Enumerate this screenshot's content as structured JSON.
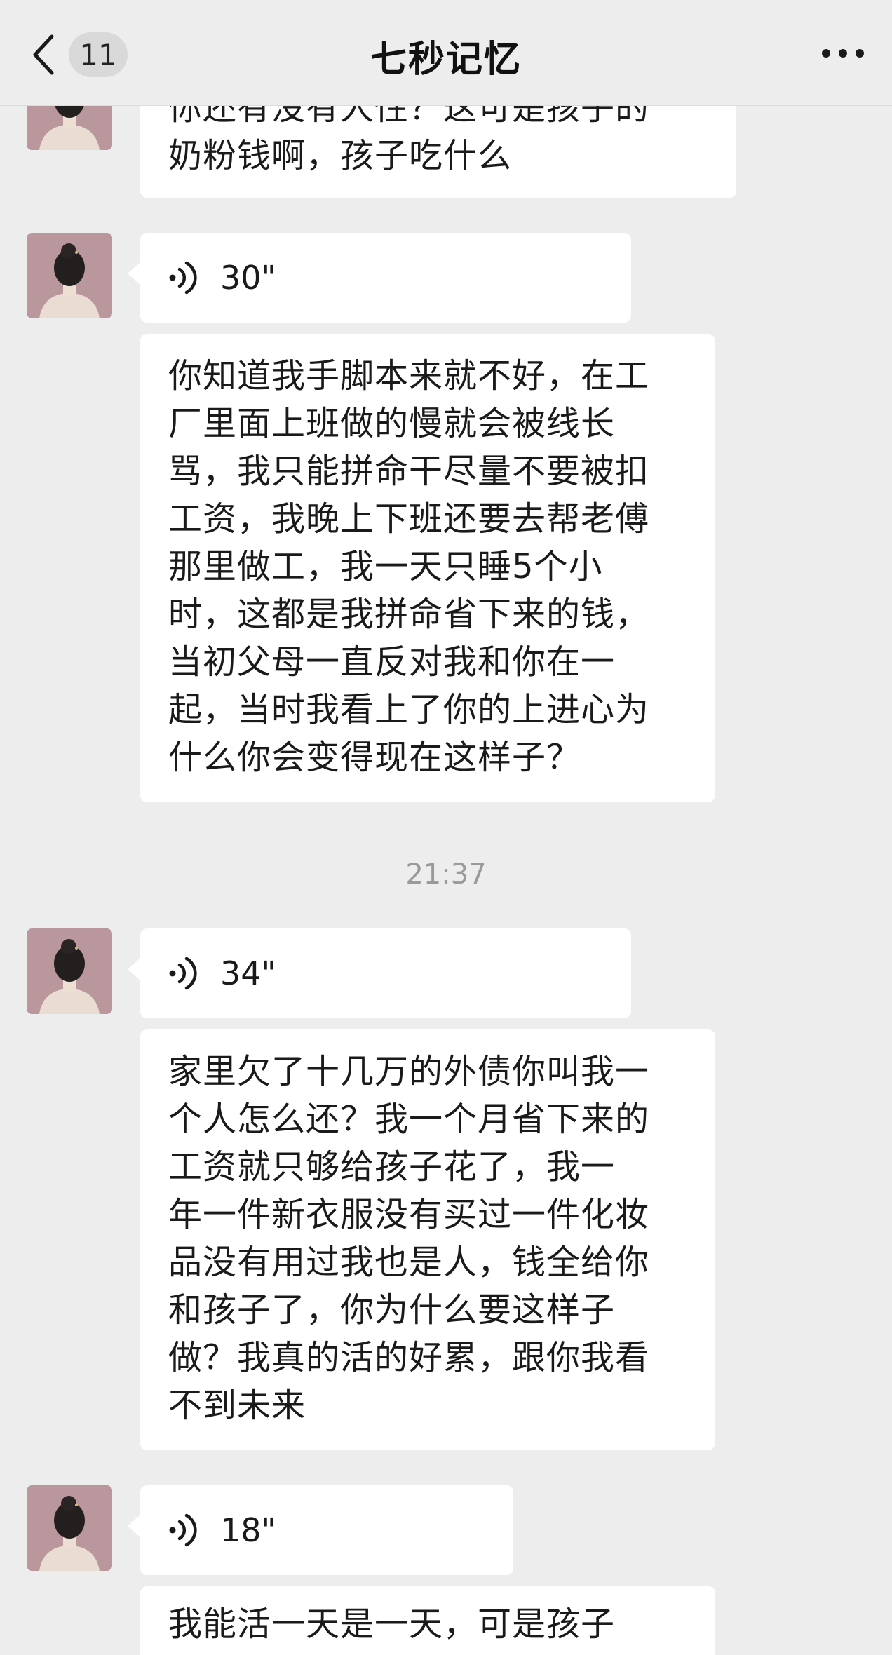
{
  "header": {
    "unread_count": "11",
    "title": "七秒记忆",
    "more_icon": "more-dots-icon",
    "back_icon": "chevron-left-icon"
  },
  "messages": [
    {
      "type": "text",
      "text": "你还有没有人性？这可是孩子的\n奶粉钱啊，孩子吃什么"
    },
    {
      "type": "voice",
      "duration": "30\""
    },
    {
      "type": "text",
      "text": "你知道我手脚本来就不好，在工\n厂里面上班做的慢就会被线长\n骂，我只能拼命干尽量不要被扣\n工资，我晚上下班还要去帮老傅\n那里做工，我一天只睡5个小\n时，这都是我拼命省下来的钱，\n当初父母一直反对我和你在一\n起，当时我看上了你的上进心为\n什么你会变得现在这样子？"
    },
    {
      "type": "time",
      "text": "21:37"
    },
    {
      "type": "voice",
      "duration": "34\""
    },
    {
      "type": "text",
      "text": "家里欠了十几万的外债你叫我一\n个人怎么还？我一个月省下来的\n工资就只够给孩子花了，我一\n年一件新衣服没有买过一件化妆\n品没有用过我也是人，钱全给你\n和孩子了，你为什么要这样子\n做？我真的活的好累，跟你我看\n不到未来"
    },
    {
      "type": "voice",
      "duration": "18\""
    },
    {
      "type": "text",
      "text": "我能活一天是一天，可是孩子"
    }
  ],
  "colors": {
    "background": "#ededed",
    "bubble": "#ffffff",
    "timestamp": "#9a9a9a"
  }
}
